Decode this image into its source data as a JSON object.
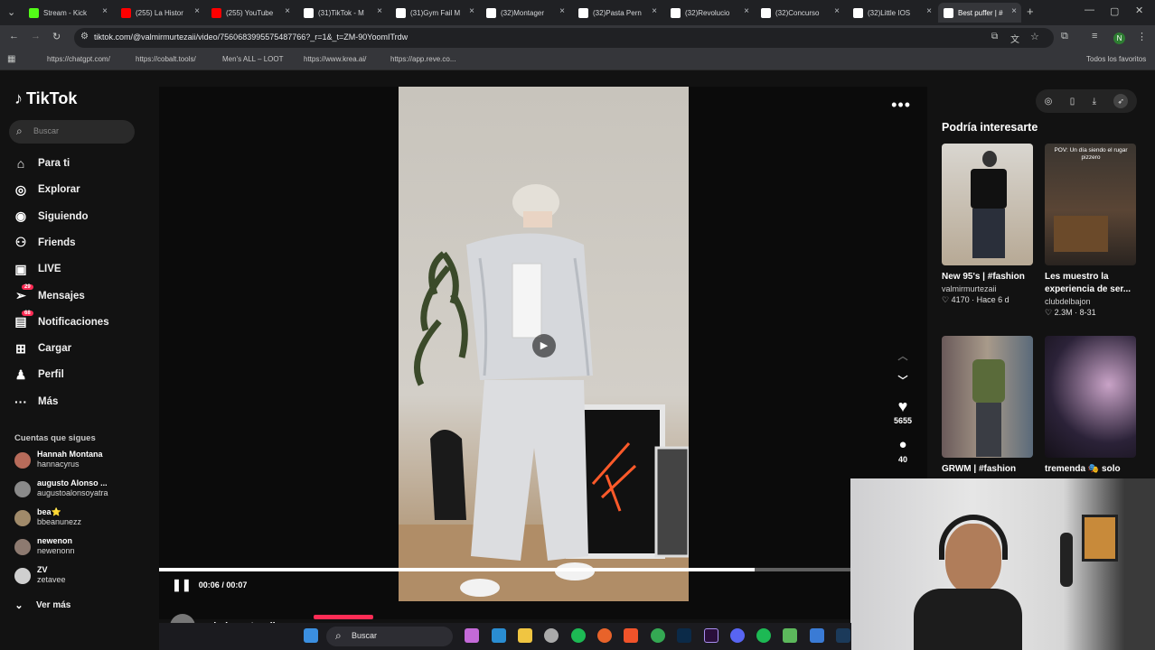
{
  "browser": {
    "tabs": [
      {
        "label": "Stream - Kick",
        "color": "#53fc18"
      },
      {
        "label": "(255) La Histor",
        "color": "#ff0000"
      },
      {
        "label": "(255) YouTube",
        "color": "#ff0000"
      },
      {
        "label": "(31)TikTok - M",
        "color": "#ffffff"
      },
      {
        "label": "(31)Gym Fail M",
        "color": "#ffffff"
      },
      {
        "label": "(32)Montager",
        "color": "#ffffff"
      },
      {
        "label": "(32)Pasta Pern",
        "color": "#ffffff"
      },
      {
        "label": "(32)Revolucio",
        "color": "#ffffff"
      },
      {
        "label": "(32)Concurso",
        "color": "#ffffff"
      },
      {
        "label": "(32)Little IOS",
        "color": "#ffffff"
      },
      {
        "label": "Best puffer | #",
        "color": "#ffffff"
      }
    ],
    "url": "tiktok.com/@valmirmurtezaii/video/7560683995575487766?_r=1&_t=ZM-90YoomITrdw",
    "bookmarks": [
      "https://chatgpt.com/",
      "https://cobalt.tools/",
      "Men's ALL – LOOT",
      "https://www.krea.ai/",
      "https://app.reve.co...",
      "Todos los favoritos"
    ]
  },
  "tiktok": {
    "logo": "TikTok",
    "search_placeholder": "Buscar",
    "nav": [
      {
        "label": "Para ti",
        "icon": "home-icon"
      },
      {
        "label": "Explorar",
        "icon": "compass-icon"
      },
      {
        "label": "Siguiendo",
        "icon": "following-icon"
      },
      {
        "label": "Friends",
        "icon": "friends-icon"
      },
      {
        "label": "LIVE",
        "icon": "live-icon"
      },
      {
        "label": "Mensajes",
        "icon": "messages-icon",
        "badge": "29"
      },
      {
        "label": "Notificaciones",
        "icon": "notifications-icon",
        "badge": "68"
      },
      {
        "label": "Cargar",
        "icon": "upload-icon"
      },
      {
        "label": "Perfil",
        "icon": "profile-icon"
      },
      {
        "label": "Más",
        "icon": "more-icon"
      }
    ],
    "following_title": "Cuentas que sigues",
    "following": [
      {
        "name": "Hannah Montana",
        "handle": "hannacyrus",
        "color": "#b76b5a"
      },
      {
        "name": "augusto Alonso ...",
        "handle": "augustoalonsoyatra",
        "color": "#8a8a8a"
      },
      {
        "name": "bea⭐",
        "handle": "bbeanunezz",
        "color": "#a08a6a"
      },
      {
        "name": "newenon",
        "handle": "newenonn",
        "color": "#8d7a70"
      },
      {
        "name": "ZV",
        "handle": "zetavee",
        "color": "#cfcfcf"
      }
    ],
    "see_more": "Ver más",
    "player": {
      "time": "00:06 / 00:07",
      "progress": 0.86,
      "likes": "5655",
      "comments": "40",
      "author": "valmirmurtezaii"
    },
    "recommended_title": "Podría interesarte",
    "recommended": [
      {
        "title": "New 95's | #fashion",
        "user": "valmirmurtezaii",
        "meta": "♡ 4170 · Hace 6 d"
      },
      {
        "title": "Les muestro la experiencia de ser...",
        "user": "clubdelbajon",
        "meta": "♡ 2.3M · 8-31",
        "overlay": "POV: Un día siendo el rugar pizzero"
      },
      {
        "title": "GRWM | #fashion",
        "user": "",
        "meta": ""
      },
      {
        "title": "tremenda 🎭 solo",
        "user": "",
        "meta": ""
      }
    ]
  },
  "taskbar": {
    "search_label": "Buscar"
  }
}
